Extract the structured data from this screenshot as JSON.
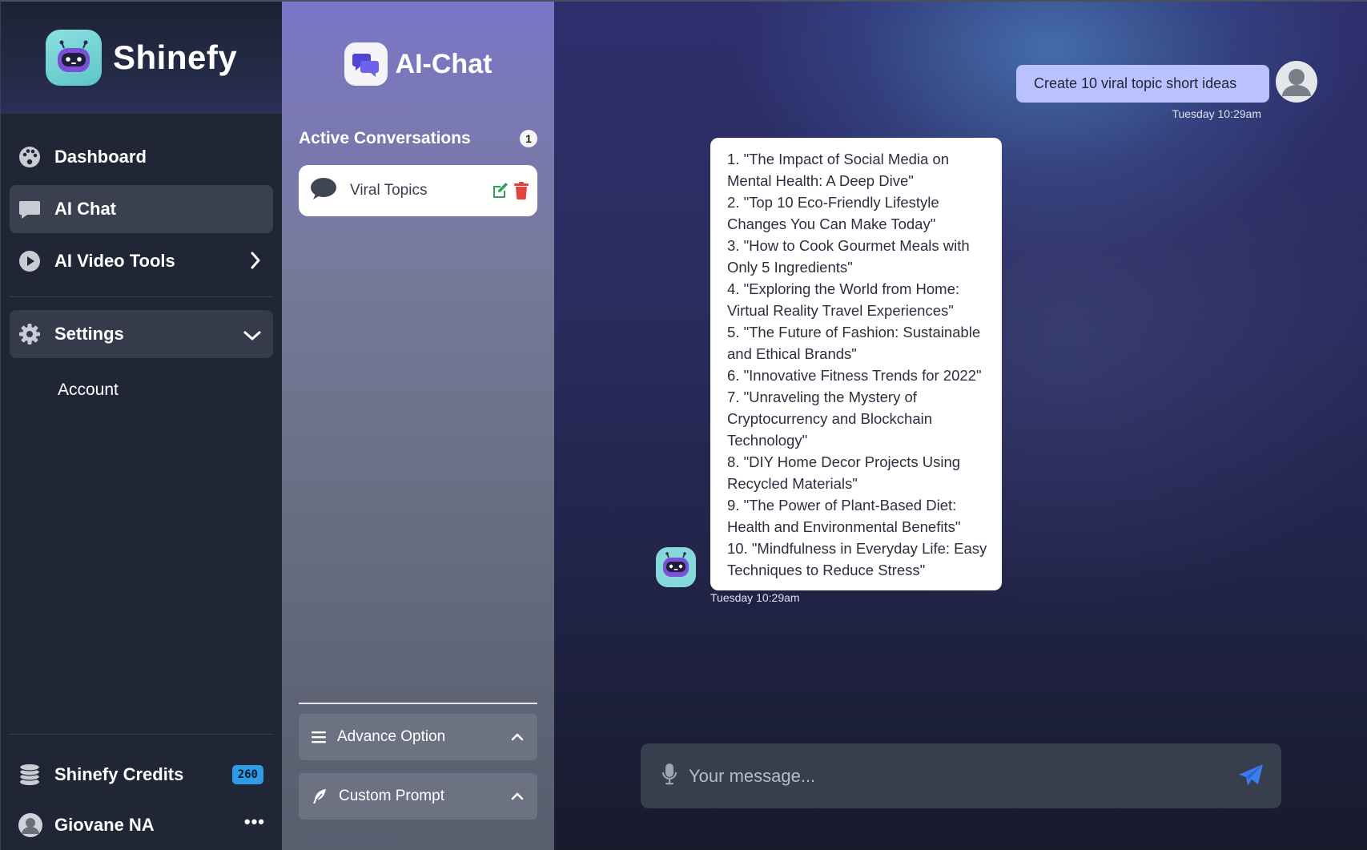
{
  "brand": {
    "name": "Shinefy"
  },
  "nav": {
    "dashboard": "Dashboard",
    "ai_chat": "AI Chat",
    "ai_video_tools": "AI Video Tools",
    "settings": "Settings",
    "account": "Account"
  },
  "sidebar_footer": {
    "credits_label": "Shinefy Credits",
    "credits_value": "260",
    "user_name": "Giovane NA"
  },
  "conversations": {
    "title": "AI-Chat",
    "active_label": "Active Conversations",
    "active_count": "1",
    "items": [
      {
        "label": "Viral Topics"
      }
    ],
    "advance_option": "Advance Option",
    "custom_prompt": "Custom Prompt"
  },
  "chat": {
    "user_message": "Create 10 viral topic short ideas",
    "user_time": "Tuesday 10:29am",
    "bot_lines": [
      "1. \"The Impact of Social Media on Mental Health: A Deep Dive\"",
      "2. \"Top 10 Eco-Friendly Lifestyle Changes You Can Make Today\"",
      "3. \"How to Cook Gourmet Meals with Only 5 Ingredients\"",
      "4. \"Exploring the World from Home: Virtual Reality Travel Experiences\"",
      "5. \"The Future of Fashion: Sustainable and Ethical Brands\"",
      "6. \"Innovative Fitness Trends for 2022\"",
      "7. \"Unraveling the Mystery of Cryptocurrency and Blockchain Technology\"",
      "8. \"DIY Home Decor Projects Using Recycled Materials\"",
      "9. \"The Power of Plant-Based Diet: Health and Environmental Benefits\"",
      "10. \"Mindfulness in Everyday Life: Easy Techniques to Reduce Stress\""
    ],
    "bot_time": "Tuesday 10:29am",
    "composer_placeholder": "Your message..."
  },
  "colors": {
    "sidebar_bg": "#202635",
    "user_bubble": "#b9c1ff",
    "credits_badge": "#2e9be6",
    "send_icon": "#3d7bf0",
    "edit_icon": "#2fa05a",
    "delete_icon": "#e0443a"
  },
  "icons": {
    "brand": "robot-icon",
    "dashboard": "palette-icon",
    "ai_chat": "chat-bubble-icon",
    "ai_video_tools": "play-circle-icon",
    "settings": "gear-icon",
    "credits": "coins-icon",
    "send": "paper-plane-icon",
    "mic": "microphone-icon"
  }
}
